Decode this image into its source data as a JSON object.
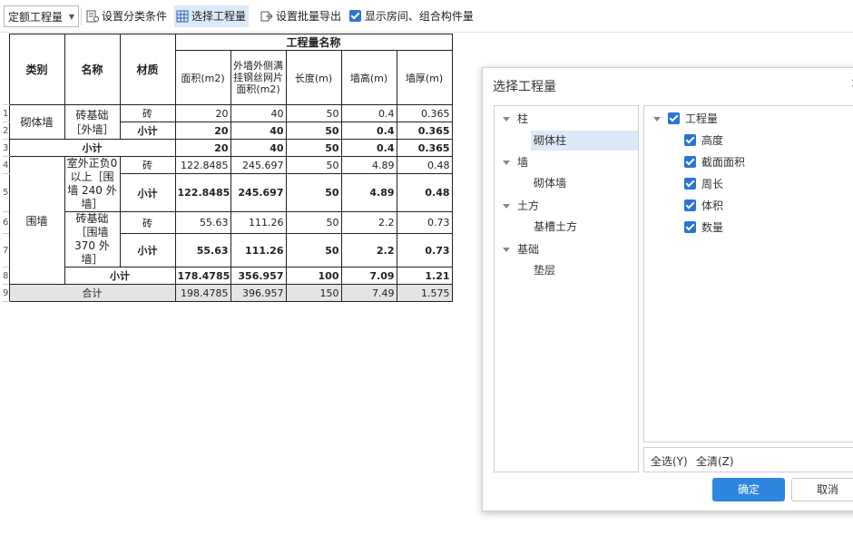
{
  "toolbar": {
    "dropdown_value": "定额工程量",
    "set_category_label": "设置分类条件",
    "select_quantity_label": "选择工程量",
    "set_batch_export_label": "设置批量导出",
    "show_rooms_label": "显示房间、组合构件量"
  },
  "table": {
    "headers": {
      "category": "类别",
      "name": "名称",
      "material": "材质",
      "group": "工程量名称",
      "area": "面积(m2)",
      "mesh_area": "外墙外侧满挂钢丝网片面积(m2)",
      "length": "长度(m)",
      "wall_height": "墙高(m)",
      "wall_thickness": "墙厚(m)"
    },
    "row_numbers": [
      "1",
      "2",
      "3",
      "4",
      "5",
      "6",
      "7",
      "8",
      "9"
    ],
    "rows": {
      "r1": {
        "category": "砌体墙",
        "name": "砖基础［外墙］",
        "material": "砖",
        "area": "20",
        "mesh": "40",
        "length": "50",
        "height": "0.4",
        "thickness": "0.365"
      },
      "r2": {
        "material": "小计",
        "area": "20",
        "mesh": "40",
        "length": "50",
        "height": "0.4",
        "thickness": "0.365"
      },
      "r3": {
        "label": "小计",
        "area": "20",
        "mesh": "40",
        "length": "50",
        "height": "0.4",
        "thickness": "0.365"
      },
      "r4": {
        "category": "围墙",
        "name": "室外正负0以上［围墙 240 外墙］",
        "material": "砖",
        "area": "122.8485",
        "mesh": "245.697",
        "length": "50",
        "height": "4.89",
        "thickness": "0.48"
      },
      "r5": {
        "material": "小计",
        "area": "122.8485",
        "mesh": "245.697",
        "length": "50",
        "height": "4.89",
        "thickness": "0.48"
      },
      "r6": {
        "name": "砖基础［围墙 370 外墙］",
        "material": "砖",
        "area": "55.63",
        "mesh": "111.26",
        "length": "50",
        "height": "2.2",
        "thickness": "0.73"
      },
      "r7": {
        "material": "小计",
        "area": "55.63",
        "mesh": "111.26",
        "length": "50",
        "height": "2.2",
        "thickness": "0.73"
      },
      "r8": {
        "label": "小计",
        "area": "178.4785",
        "mesh": "356.957",
        "length": "100",
        "height": "7.09",
        "thickness": "1.21"
      },
      "r9": {
        "label": "合计",
        "area": "198.4785",
        "mesh": "396.957",
        "length": "150",
        "height": "7.49",
        "thickness": "1.575"
      }
    }
  },
  "dialog": {
    "title": "选择工程量",
    "close": "×",
    "tree": [
      {
        "label": "柱",
        "children": [
          "砌体柱"
        ]
      },
      {
        "label": "墙",
        "children": [
          "砌体墙"
        ]
      },
      {
        "label": "土方",
        "children": [
          "基槽土方"
        ]
      },
      {
        "label": "基础",
        "children": [
          "垫层"
        ]
      }
    ],
    "selected_child": "砌体柱",
    "quantities_root": "工程量",
    "quantities": [
      "高度",
      "截面面积",
      "周长",
      "体积",
      "数量"
    ],
    "select_all": "全选(Y)",
    "clear_all": "全清(Z)",
    "ok": "确定",
    "cancel": "取消"
  }
}
